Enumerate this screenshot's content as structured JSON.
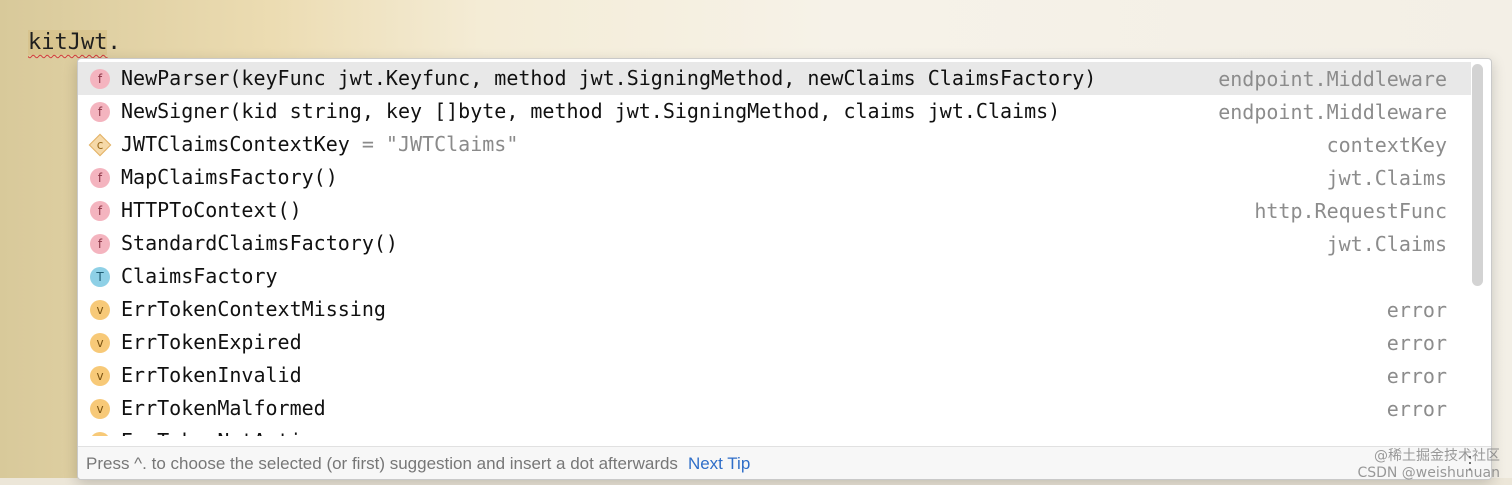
{
  "editor": {
    "identifier": "kitJwt",
    "dot": "."
  },
  "completion": {
    "items": [
      {
        "kind": "f",
        "label": "NewParser(keyFunc jwt.Keyfunc, method jwt.SigningMethod, newClaims ClaimsFactory)",
        "suffix": "",
        "type": "endpoint.Middleware",
        "selected": true
      },
      {
        "kind": "f",
        "label": "NewSigner(kid string, key []byte, method jwt.SigningMethod, claims jwt.Claims)",
        "suffix": "",
        "type": "endpoint.Middleware"
      },
      {
        "kind": "c",
        "label": "JWTClaimsContextKey",
        "suffix": " = \"JWTClaims\"",
        "type": "contextKey"
      },
      {
        "kind": "f",
        "label": "MapClaimsFactory()",
        "suffix": "",
        "type": "jwt.Claims"
      },
      {
        "kind": "f",
        "label": "HTTPToContext()",
        "suffix": "",
        "type": "http.RequestFunc"
      },
      {
        "kind": "f",
        "label": "StandardClaimsFactory()",
        "suffix": "",
        "type": "jwt.Claims"
      },
      {
        "kind": "t",
        "label": "ClaimsFactory",
        "suffix": "",
        "type": ""
      },
      {
        "kind": "v",
        "label": "ErrTokenContextMissing",
        "suffix": "",
        "type": "error"
      },
      {
        "kind": "v",
        "label": "ErrTokenExpired",
        "suffix": "",
        "type": "error"
      },
      {
        "kind": "v",
        "label": "ErrTokenInvalid",
        "suffix": "",
        "type": "error"
      },
      {
        "kind": "v",
        "label": "ErrTokenMalformed",
        "suffix": "",
        "type": "error"
      },
      {
        "kind": "v",
        "label": "ErrTokenNotActive",
        "suffix": "",
        "type": "error"
      }
    ],
    "badge_letters": {
      "f": "f",
      "c": "c",
      "t": "T",
      "v": "v"
    },
    "footer": {
      "hint": "Press ^. to choose the selected (or first) suggestion and insert a dot afterwards",
      "tip_link": "Next Tip",
      "more_icon": "⋮"
    }
  },
  "watermark": {
    "line1": "@稀土掘金技术社区",
    "line2": "CSDN @weishunuan"
  }
}
